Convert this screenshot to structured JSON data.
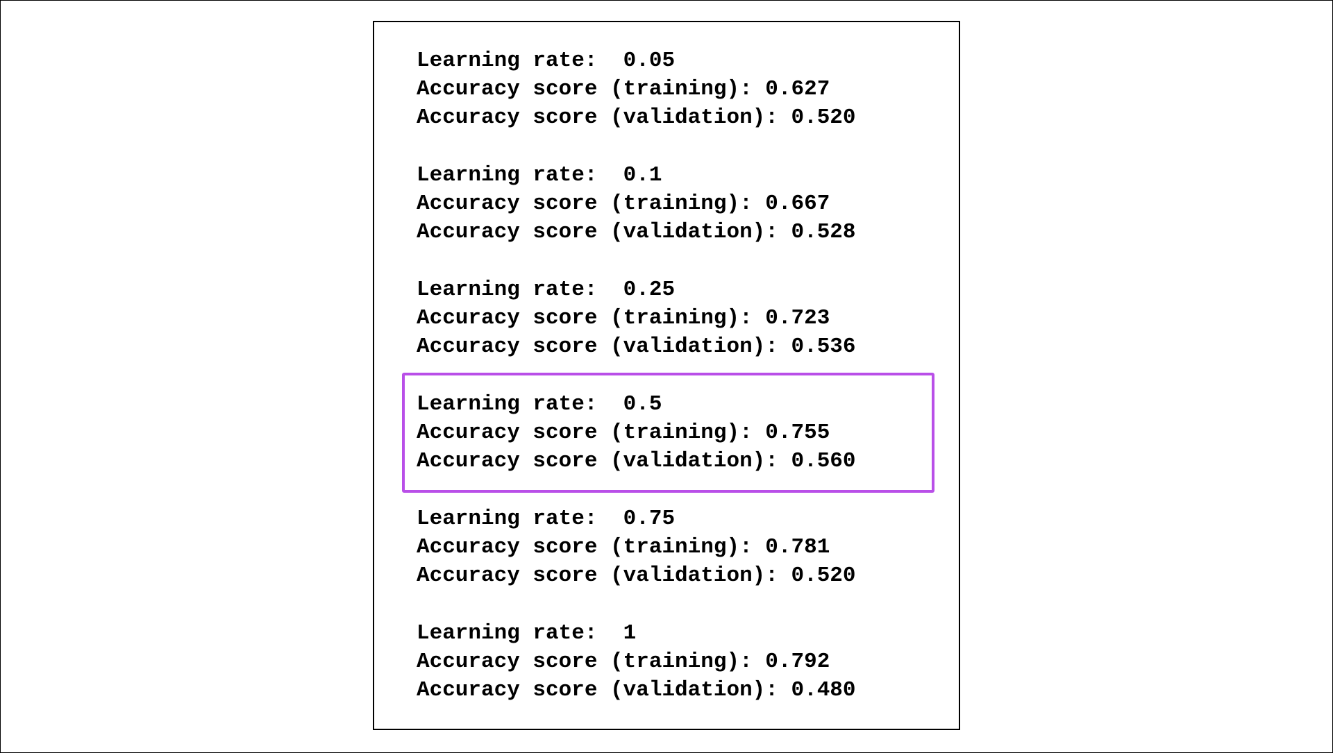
{
  "accent_color": "#b94fe8",
  "results": [
    {
      "lr_label": "Learning rate:  ",
      "lr": "0.05",
      "train_label": "Accuracy score (training): ",
      "train": "0.627",
      "val_label": "Accuracy score (validation): ",
      "val": "0.520"
    },
    {
      "lr_label": "Learning rate:  ",
      "lr": "0.1",
      "train_label": "Accuracy score (training): ",
      "train": "0.667",
      "val_label": "Accuracy score (validation): ",
      "val": "0.528"
    },
    {
      "lr_label": "Learning rate:  ",
      "lr": "0.25",
      "train_label": "Accuracy score (training): ",
      "train": "0.723",
      "val_label": "Accuracy score (validation): ",
      "val": "0.536"
    },
    {
      "lr_label": "Learning rate:  ",
      "lr": "0.5",
      "train_label": "Accuracy score (training): ",
      "train": "0.755",
      "val_label": "Accuracy score (validation): ",
      "val": "0.560"
    },
    {
      "lr_label": "Learning rate:  ",
      "lr": "0.75",
      "train_label": "Accuracy score (training): ",
      "train": "0.781",
      "val_label": "Accuracy score (validation): ",
      "val": "0.520"
    },
    {
      "lr_label": "Learning rate:  ",
      "lr": "1",
      "train_label": "Accuracy score (training): ",
      "train": "0.792",
      "val_label": "Accuracy score (validation): ",
      "val": "0.480"
    }
  ],
  "highlighted_result": 3
}
